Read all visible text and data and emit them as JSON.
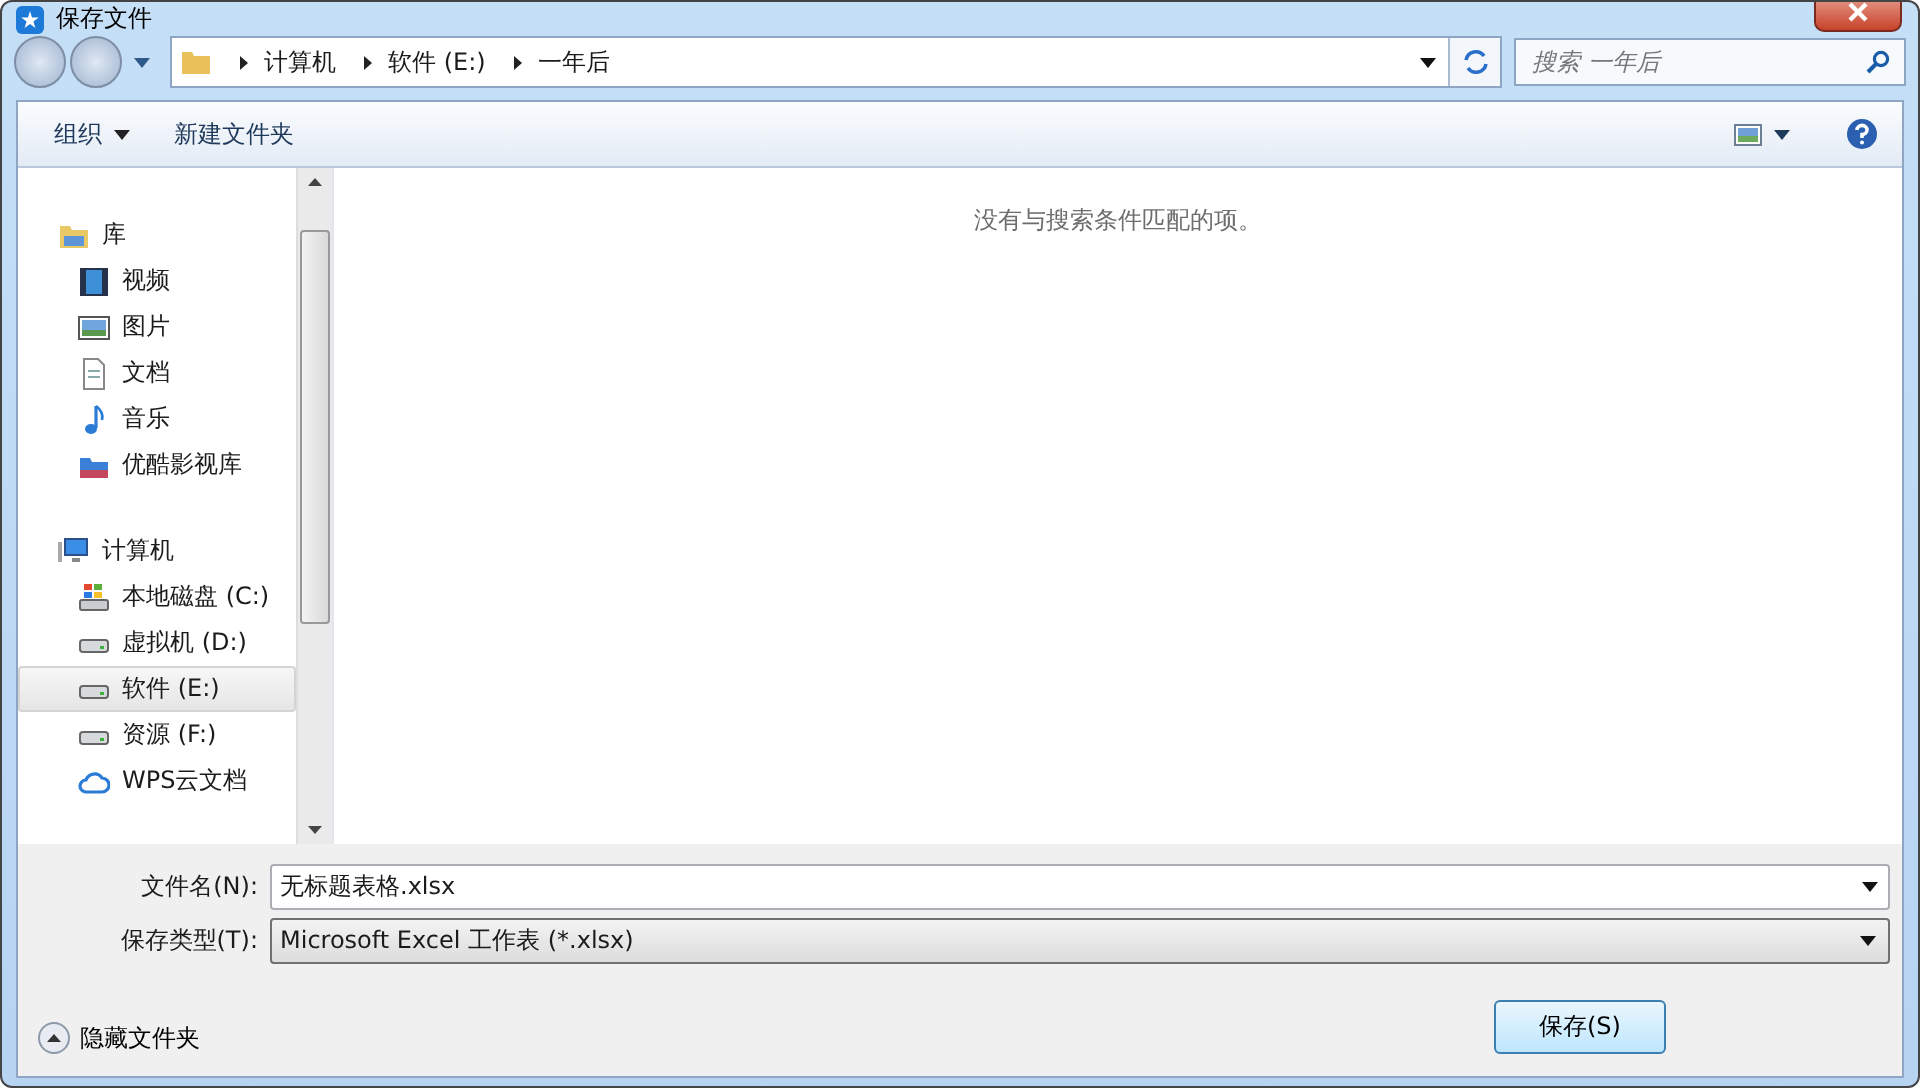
{
  "window": {
    "title": "保存文件"
  },
  "address": {
    "path": [
      {
        "label": "计算机"
      },
      {
        "label": "软件 (E:)"
      },
      {
        "label": "一年后"
      }
    ]
  },
  "search": {
    "placeholder": "搜索 一年后"
  },
  "toolbar": {
    "organize": "组织",
    "new_folder": "新建文件夹"
  },
  "sidebar": {
    "groups": [
      {
        "label": "库",
        "kind": "library",
        "children": [
          {
            "label": "视频",
            "kind": "video",
            "selected": false
          },
          {
            "label": "图片",
            "kind": "picture",
            "selected": false
          },
          {
            "label": "文档",
            "kind": "document",
            "selected": false
          },
          {
            "label": "音乐",
            "kind": "music",
            "selected": false
          },
          {
            "label": "优酷影视库",
            "kind": "media",
            "selected": false
          }
        ]
      },
      {
        "label": "计算机",
        "kind": "computer",
        "children": [
          {
            "label": "本地磁盘 (C:)",
            "kind": "system-drive",
            "selected": false
          },
          {
            "label": "虚拟机 (D:)",
            "kind": "drive",
            "selected": false
          },
          {
            "label": "软件 (E:)",
            "kind": "drive",
            "selected": true
          },
          {
            "label": "资源 (F:)",
            "kind": "drive",
            "selected": false
          },
          {
            "label": "WPS云文档",
            "kind": "cloud",
            "selected": false
          }
        ]
      }
    ]
  },
  "content": {
    "empty_message": "没有与搜索条件匹配的项。"
  },
  "form": {
    "filename_label": "文件名(N):",
    "filename": "无标题表格.xlsx",
    "type_label": "保存类型(T):",
    "type": "Microsoft Excel 工作表 (*.xlsx)"
  },
  "footer": {
    "hide_folders": "隐藏文件夹",
    "save_button": "保存(S)"
  }
}
